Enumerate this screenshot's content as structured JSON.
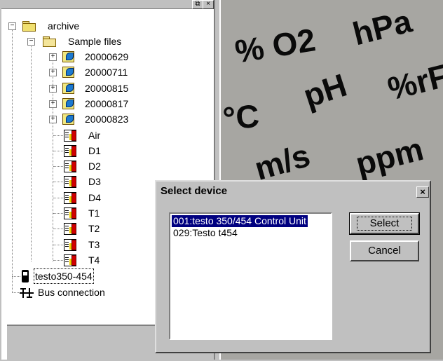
{
  "tree": {
    "nodes": [
      {
        "label": "archive"
      },
      {
        "label": "Sample files"
      },
      {
        "label": "20000629"
      },
      {
        "label": "20000711"
      },
      {
        "label": "20000815"
      },
      {
        "label": "20000817"
      },
      {
        "label": "20000823"
      },
      {
        "label": "Air"
      },
      {
        "label": "D1"
      },
      {
        "label": "D2"
      },
      {
        "label": "D3"
      },
      {
        "label": "D4"
      },
      {
        "label": "T1"
      },
      {
        "label": "T2"
      },
      {
        "label": "T3"
      },
      {
        "label": "T4"
      },
      {
        "label": "testo350-454"
      },
      {
        "label": "Bus connection"
      }
    ]
  },
  "units": [
    "% O2",
    "hPa",
    "°C",
    "pH",
    "%rF",
    "m/s",
    "ppm"
  ],
  "dialog": {
    "title": "Select device",
    "close_glyph": "×",
    "devices": [
      {
        "label": "001:testo 350/454 Control Unit",
        "selected": true
      },
      {
        "label": "029:Testo t454",
        "selected": false
      }
    ],
    "select_label": "Select",
    "cancel_label": "Cancel"
  },
  "colors": {
    "selection": "#000080",
    "background": "#a7a6a2",
    "chrome": "#c0c0c0"
  }
}
